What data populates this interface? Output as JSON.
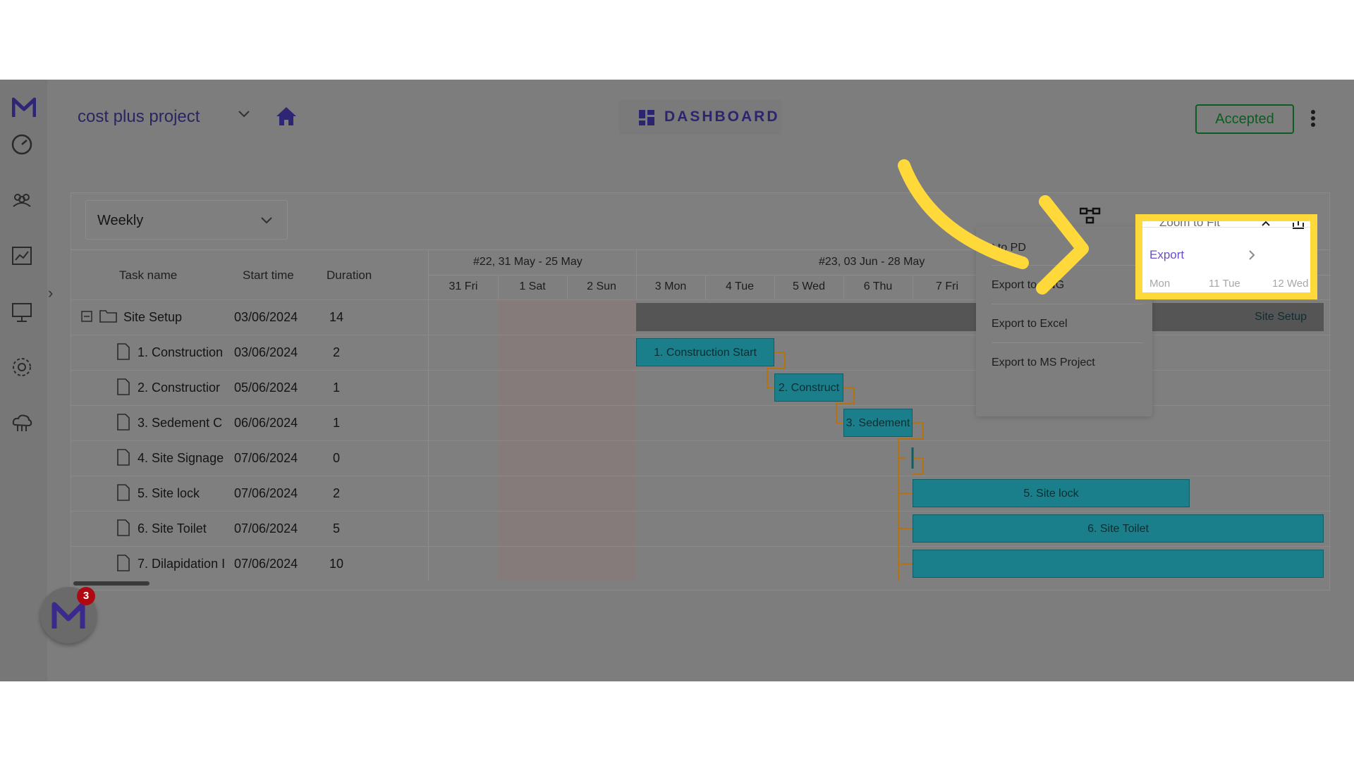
{
  "header": {
    "project_name": "cost plus project",
    "dashboard_label": "DASHBOARD",
    "status": "Accepted"
  },
  "toolbar": {
    "view_select": "Weekly"
  },
  "grid": {
    "columns": [
      "Task name",
      "Start time",
      "Duration"
    ],
    "rows": [
      {
        "name": "Site Setup",
        "start": "03/06/2024",
        "duration": "14",
        "type": "summary"
      },
      {
        "name": "1. Construction",
        "start": "03/06/2024",
        "duration": "2",
        "type": "task"
      },
      {
        "name": "2. Constructior",
        "start": "05/06/2024",
        "duration": "1",
        "type": "task"
      },
      {
        "name": "3. Sedement C",
        "start": "06/06/2024",
        "duration": "1",
        "type": "task"
      },
      {
        "name": "4. Site Signage",
        "start": "07/06/2024",
        "duration": "0",
        "type": "task"
      },
      {
        "name": "5. Site lock",
        "start": "07/06/2024",
        "duration": "2",
        "type": "task"
      },
      {
        "name": "6. Site Toilet",
        "start": "07/06/2024",
        "duration": "5",
        "type": "task"
      },
      {
        "name": "7. Dilapidation I",
        "start": "07/06/2024",
        "duration": "10",
        "type": "task"
      }
    ]
  },
  "timeline": {
    "weeks": [
      "#22, 31 May - 25 May",
      "#23, 03 Jun - 28 May"
    ],
    "days": [
      "31 Fri",
      "1 Sat",
      "2 Sun",
      "3 Mon",
      "4 Tue",
      "5 Wed",
      "6 Thu",
      "7 Fri"
    ]
  },
  "bars": {
    "summary": "Site Setup",
    "b1": "1. Construction Start",
    "b2": "2. Construct",
    "b3": "3. Sedement",
    "b5": "5. Site lock",
    "b6": "6. Site Toilet"
  },
  "export_menu": {
    "partial_top": "t to PD",
    "items": [
      "Export to PNG",
      "Export to Excel",
      "Export to MS Project"
    ]
  },
  "highlight": {
    "partial_title": "Zoom to Fit",
    "export_label": "Export",
    "days": [
      "Mon",
      "11 Tue",
      "12 Wed"
    ]
  },
  "fab": {
    "badge": "3"
  },
  "colors": {
    "brand": "#3b2a8c",
    "accent_yellow": "#ffd93a",
    "status_green": "#0d5c22",
    "task_bar": "#1a7f8a"
  }
}
